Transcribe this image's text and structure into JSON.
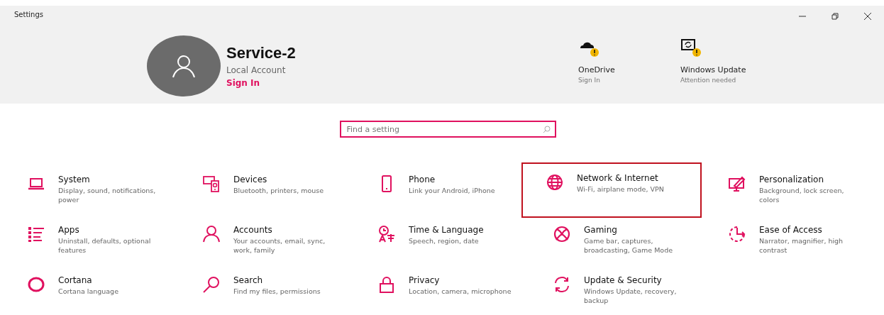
{
  "window": {
    "title": "Settings"
  },
  "account": {
    "name": "Service-2",
    "type": "Local Account",
    "link": "Sign In"
  },
  "status_items": [
    {
      "title": "OneDrive",
      "subtitle": "Sign In",
      "warning": true
    },
    {
      "title": "Windows Update",
      "subtitle": "Attention needed",
      "warning": true
    }
  ],
  "search": {
    "placeholder": "Find a setting"
  },
  "categories": [
    {
      "title": "System",
      "subtitle": "Display, sound, notifications, power",
      "highlighted": false
    },
    {
      "title": "Devices",
      "subtitle": "Bluetooth, printers, mouse",
      "highlighted": false
    },
    {
      "title": "Phone",
      "subtitle": "Link your Android, iPhone",
      "highlighted": false
    },
    {
      "title": "Network & Internet",
      "subtitle": "Wi-Fi, airplane mode, VPN",
      "highlighted": true
    },
    {
      "title": "Personalization",
      "subtitle": "Background, lock screen, colors",
      "highlighted": false
    },
    {
      "title": "Apps",
      "subtitle": "Uninstall, defaults, optional features",
      "highlighted": false
    },
    {
      "title": "Accounts",
      "subtitle": "Your accounts, email, sync, work, family",
      "highlighted": false
    },
    {
      "title": "Time & Language",
      "subtitle": "Speech, region, date",
      "highlighted": false
    },
    {
      "title": "Gaming",
      "subtitle": "Game bar, captures, broadcasting, Game Mode",
      "highlighted": false
    },
    {
      "title": "Ease of Access",
      "subtitle": "Narrator, magnifier, high contrast",
      "highlighted": false
    },
    {
      "title": "Cortana",
      "subtitle": "Cortana language",
      "highlighted": false
    },
    {
      "title": "Search",
      "subtitle": "Find my files, permissions",
      "highlighted": false
    },
    {
      "title": "Privacy",
      "subtitle": "Location, camera, microphone",
      "highlighted": false
    },
    {
      "title": "Update & Security",
      "subtitle": "Windows Update, recovery, backup",
      "highlighted": false
    }
  ]
}
